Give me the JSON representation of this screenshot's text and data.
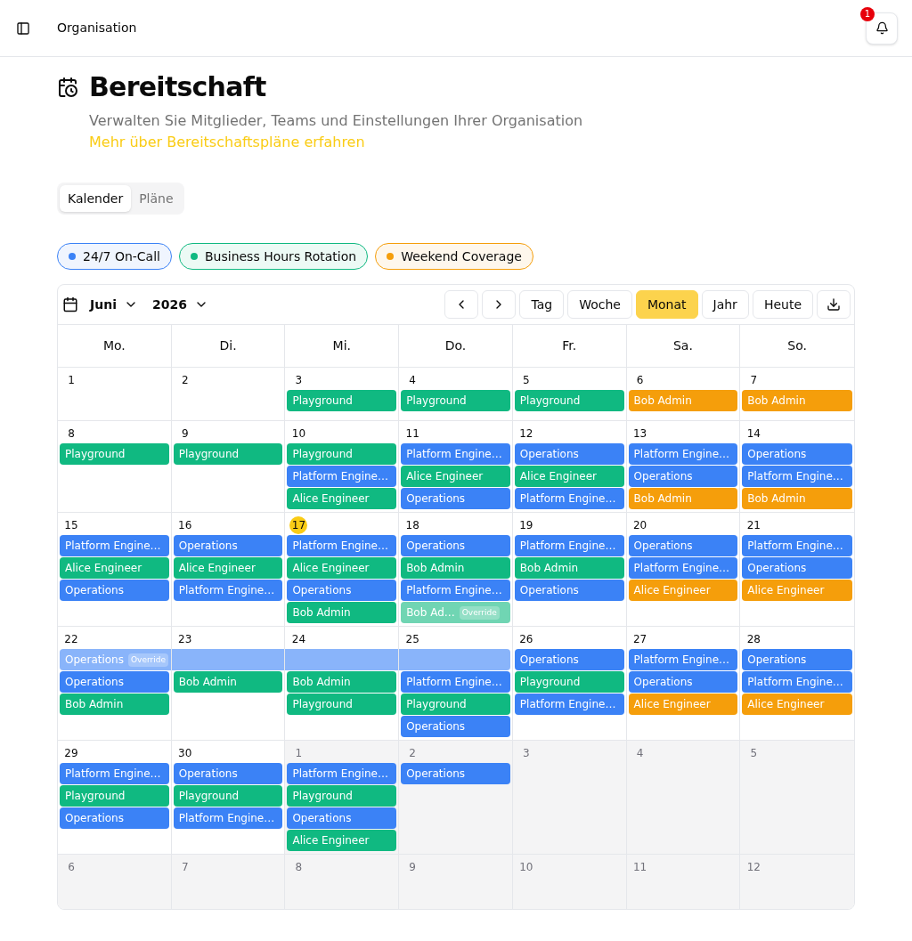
{
  "top_bar": {
    "title": "Organisation",
    "notification_count": "1"
  },
  "page": {
    "title": "Bereitschaft",
    "description": "Verwalten Sie Mitglieder, Teams und Einstellungen Ihrer Organisation",
    "link": "Mehr über Bereitschaftspläne erfahren"
  },
  "tabs": [
    {
      "label": "Kalender",
      "selected": true
    },
    {
      "label": "Pläne",
      "selected": false
    }
  ],
  "legend": [
    {
      "label": "24/7 On-Call",
      "color": "#3b82f6"
    },
    {
      "label": "Business Hours Rotation",
      "color": "#10b981"
    },
    {
      "label": "Weekend Coverage",
      "color": "#f59e0b"
    }
  ],
  "calendar": {
    "month": "Juni",
    "year": "2026",
    "views": [
      {
        "label": "Tag",
        "selected": false
      },
      {
        "label": "Woche",
        "selected": false
      },
      {
        "label": "Monat",
        "selected": true
      },
      {
        "label": "Jahr",
        "selected": false
      }
    ],
    "today_button": "Heute",
    "weekdays": [
      "Mo.",
      "Di.",
      "Mi.",
      "Do.",
      "Fr.",
      "Sa.",
      "So."
    ],
    "weeks": [
      {
        "days": [
          {
            "date": "1",
            "in_month": true,
            "today": false
          },
          {
            "date": "2",
            "in_month": true,
            "today": false
          },
          {
            "date": "3",
            "in_month": true,
            "today": false,
            "events": [
              {
                "kind": "shift",
                "label": "Playground",
                "color": "#10b981"
              }
            ]
          },
          {
            "date": "4",
            "in_month": true,
            "today": false,
            "events": [
              {
                "kind": "shift",
                "label": "Playground",
                "color": "#10b981"
              }
            ]
          },
          {
            "date": "5",
            "in_month": true,
            "today": false,
            "events": [
              {
                "kind": "shift",
                "label": "Playground",
                "color": "#10b981"
              }
            ]
          },
          {
            "date": "6",
            "in_month": true,
            "today": false,
            "events": [
              {
                "kind": "shift",
                "label": "Bob Admin",
                "color": "#f59e0b"
              }
            ]
          },
          {
            "date": "7",
            "in_month": true,
            "today": false,
            "events": [
              {
                "kind": "shift",
                "label": "Bob Admin",
                "color": "#f59e0b"
              }
            ]
          }
        ]
      },
      {
        "days": [
          {
            "date": "8",
            "in_month": true,
            "today": false,
            "events": [
              {
                "kind": "shift",
                "label": "Playground",
                "color": "#10b981"
              }
            ]
          },
          {
            "date": "9",
            "in_month": true,
            "today": false,
            "events": [
              {
                "kind": "shift",
                "label": "Playground",
                "color": "#10b981"
              }
            ]
          },
          {
            "date": "10",
            "in_month": true,
            "today": false,
            "events": [
              {
                "kind": "shift",
                "label": "Playground",
                "color": "#10b981"
              },
              {
                "kind": "shift",
                "label": "Platform Engine…",
                "color": "#3b82f6"
              },
              {
                "kind": "shift",
                "label": "Alice Engineer",
                "color": "#10b981"
              }
            ]
          },
          {
            "date": "11",
            "in_month": true,
            "today": false,
            "events": [
              {
                "kind": "shift",
                "label": "Platform Engine…",
                "color": "#3b82f6"
              },
              {
                "kind": "shift",
                "label": "Alice Engineer",
                "color": "#10b981"
              },
              {
                "kind": "shift",
                "label": "Operations",
                "color": "#3b82f6"
              }
            ]
          },
          {
            "date": "12",
            "in_month": true,
            "today": false,
            "events": [
              {
                "kind": "shift",
                "label": "Operations",
                "color": "#3b82f6"
              },
              {
                "kind": "shift",
                "label": "Alice Engineer",
                "color": "#10b981"
              },
              {
                "kind": "shift",
                "label": "Platform Engine…",
                "color": "#3b82f6"
              }
            ]
          },
          {
            "date": "13",
            "in_month": true,
            "today": false,
            "events": [
              {
                "kind": "shift",
                "label": "Platform Engine…",
                "color": "#3b82f6"
              },
              {
                "kind": "shift",
                "label": "Operations",
                "color": "#3b82f6"
              },
              {
                "kind": "shift",
                "label": "Bob Admin",
                "color": "#f59e0b"
              }
            ]
          },
          {
            "date": "14",
            "in_month": true,
            "today": false,
            "events": [
              {
                "kind": "shift",
                "label": "Operations",
                "color": "#3b82f6"
              },
              {
                "kind": "shift",
                "label": "Platform Engine…",
                "color": "#3b82f6"
              },
              {
                "kind": "shift",
                "label": "Bob Admin",
                "color": "#f59e0b"
              }
            ]
          }
        ]
      },
      {
        "days": [
          {
            "date": "15",
            "in_month": true,
            "today": false,
            "events": [
              {
                "kind": "shift",
                "label": "Platform Engine…",
                "color": "#3b82f6"
              },
              {
                "kind": "shift",
                "label": "Alice Engineer",
                "color": "#10b981"
              },
              {
                "kind": "shift",
                "label": "Operations",
                "color": "#3b82f6"
              }
            ]
          },
          {
            "date": "16",
            "in_month": true,
            "today": false,
            "events": [
              {
                "kind": "shift",
                "label": "Operations",
                "color": "#3b82f6"
              },
              {
                "kind": "shift",
                "label": "Alice Engineer",
                "color": "#10b981"
              },
              {
                "kind": "shift",
                "label": "Platform Engine…",
                "color": "#3b82f6"
              }
            ]
          },
          {
            "date": "17",
            "in_month": true,
            "today": true,
            "events": [
              {
                "kind": "shift",
                "label": "Platform Engine…",
                "color": "#3b82f6"
              },
              {
                "kind": "shift",
                "label": "Alice Engineer",
                "color": "#10b981"
              },
              {
                "kind": "shift",
                "label": "Operations",
                "color": "#3b82f6"
              },
              {
                "kind": "shift",
                "label": "Bob Admin",
                "color": "#10b981"
              }
            ]
          },
          {
            "date": "18",
            "in_month": true,
            "today": false,
            "events": [
              {
                "kind": "shift",
                "label": "Operations",
                "color": "#3b82f6"
              },
              {
                "kind": "shift",
                "label": "Bob Admin",
                "color": "#10b981"
              },
              {
                "kind": "shift",
                "label": "Platform Engine…",
                "color": "#3b82f6"
              },
              {
                "kind": "shift",
                "label": "Bob Ad…",
                "badge": "Override",
                "color": "#70d5b3"
              }
            ]
          },
          {
            "date": "19",
            "in_month": true,
            "today": false,
            "events": [
              {
                "kind": "shift",
                "label": "Platform Engine…",
                "color": "#3b82f6"
              },
              {
                "kind": "shift",
                "label": "Bob Admin",
                "color": "#10b981"
              },
              {
                "kind": "shift",
                "label": "Operations",
                "color": "#3b82f6"
              }
            ]
          },
          {
            "date": "20",
            "in_month": true,
            "today": false,
            "events": [
              {
                "kind": "shift",
                "label": "Operations",
                "color": "#3b82f6"
              },
              {
                "kind": "shift",
                "label": "Platform Engine…",
                "color": "#3b82f6"
              },
              {
                "kind": "shift",
                "label": "Alice Engineer",
                "color": "#f59e0b"
              }
            ]
          },
          {
            "date": "21",
            "in_month": true,
            "today": false,
            "events": [
              {
                "kind": "shift",
                "label": "Platform Engine…",
                "color": "#3b82f6"
              },
              {
                "kind": "shift",
                "label": "Operations",
                "color": "#3b82f6"
              },
              {
                "kind": "shift",
                "label": "Alice Engineer",
                "color": "#f59e0b"
              }
            ]
          }
        ]
      },
      {
        "days": [
          {
            "date": "22",
            "in_month": true,
            "today": false,
            "events": [
              {
                "kind": "span_start",
                "label": "Operations",
                "badge": "Override",
                "color": "#89b4fa"
              },
              {
                "kind": "shift",
                "label": "Operations",
                "color": "#3b82f6"
              },
              {
                "kind": "shift",
                "label": "Bob Admin",
                "color": "#10b981"
              }
            ]
          },
          {
            "date": "23",
            "in_month": true,
            "today": false,
            "events": [
              {
                "kind": "span_continued",
                "color": "#89b4fa"
              },
              {
                "kind": "shift",
                "label": "Bob Admin",
                "color": "#10b981"
              }
            ]
          },
          {
            "date": "24",
            "in_month": true,
            "today": false,
            "events": [
              {
                "kind": "span_continued",
                "color": "#89b4fa"
              },
              {
                "kind": "shift",
                "label": "Bob Admin",
                "color": "#10b981"
              },
              {
                "kind": "shift",
                "label": "Playground",
                "color": "#10b981"
              }
            ]
          },
          {
            "date": "25",
            "in_month": true,
            "today": false,
            "events": [
              {
                "kind": "span_continued",
                "color": "#89b4fa"
              },
              {
                "kind": "shift",
                "label": "Platform Engine…",
                "color": "#3b82f6"
              },
              {
                "kind": "shift",
                "label": "Playground",
                "color": "#10b981"
              },
              {
                "kind": "shift",
                "label": "Operations",
                "color": "#3b82f6"
              }
            ]
          },
          {
            "date": "26",
            "in_month": true,
            "today": false,
            "events": [
              {
                "kind": "shift",
                "label": "Operations",
                "color": "#3b82f6"
              },
              {
                "kind": "shift",
                "label": "Playground",
                "color": "#10b981"
              },
              {
                "kind": "shift",
                "label": "Platform Engine…",
                "color": "#3b82f6"
              }
            ]
          },
          {
            "date": "27",
            "in_month": true,
            "today": false,
            "events": [
              {
                "kind": "shift",
                "label": "Platform Engine…",
                "color": "#3b82f6"
              },
              {
                "kind": "shift",
                "label": "Operations",
                "color": "#3b82f6"
              },
              {
                "kind": "shift",
                "label": "Alice Engineer",
                "color": "#f59e0b"
              }
            ]
          },
          {
            "date": "28",
            "in_month": true,
            "today": false,
            "events": [
              {
                "kind": "shift",
                "label": "Operations",
                "color": "#3b82f6"
              },
              {
                "kind": "shift",
                "label": "Platform Engine…",
                "color": "#3b82f6"
              },
              {
                "kind": "shift",
                "label": "Alice Engineer",
                "color": "#f59e0b"
              }
            ]
          }
        ]
      },
      {
        "days": [
          {
            "date": "29",
            "in_month": true,
            "today": false,
            "events": [
              {
                "kind": "shift",
                "label": "Platform Engine…",
                "color": "#3b82f6"
              },
              {
                "kind": "shift",
                "label": "Playground",
                "color": "#10b981"
              },
              {
                "kind": "shift",
                "label": "Operations",
                "color": "#3b82f6"
              }
            ]
          },
          {
            "date": "30",
            "in_month": true,
            "today": false,
            "events": [
              {
                "kind": "shift",
                "label": "Operations",
                "color": "#3b82f6"
              },
              {
                "kind": "shift",
                "label": "Playground",
                "color": "#10b981"
              },
              {
                "kind": "shift",
                "label": "Platform Engine…",
                "color": "#3b82f6"
              }
            ]
          },
          {
            "date": "1",
            "in_month": false,
            "today": false,
            "events": [
              {
                "kind": "shift",
                "label": "Platform Engine…",
                "color": "#3b82f6"
              },
              {
                "kind": "shift",
                "label": "Playground",
                "color": "#10b981"
              },
              {
                "kind": "shift",
                "label": "Operations",
                "color": "#3b82f6"
              },
              {
                "kind": "shift",
                "label": "Alice Engineer",
                "color": "#10b981"
              }
            ]
          },
          {
            "date": "2",
            "in_month": false,
            "today": false,
            "events": [
              {
                "kind": "shift",
                "label": "Operations",
                "color": "#3b82f6"
              }
            ]
          },
          {
            "date": "3",
            "in_month": false,
            "today": false
          },
          {
            "date": "4",
            "in_month": false,
            "today": false
          },
          {
            "date": "5",
            "in_month": false,
            "today": false
          }
        ]
      },
      {
        "days": [
          {
            "date": "6",
            "in_month": false,
            "today": false
          },
          {
            "date": "7",
            "in_month": false,
            "today": false
          },
          {
            "date": "8",
            "in_month": false,
            "today": false
          },
          {
            "date": "9",
            "in_month": false,
            "today": false
          },
          {
            "date": "10",
            "in_month": false,
            "today": false
          },
          {
            "date": "11",
            "in_month": false,
            "today": false
          },
          {
            "date": "12",
            "in_month": false,
            "today": false
          }
        ]
      }
    ]
  }
}
